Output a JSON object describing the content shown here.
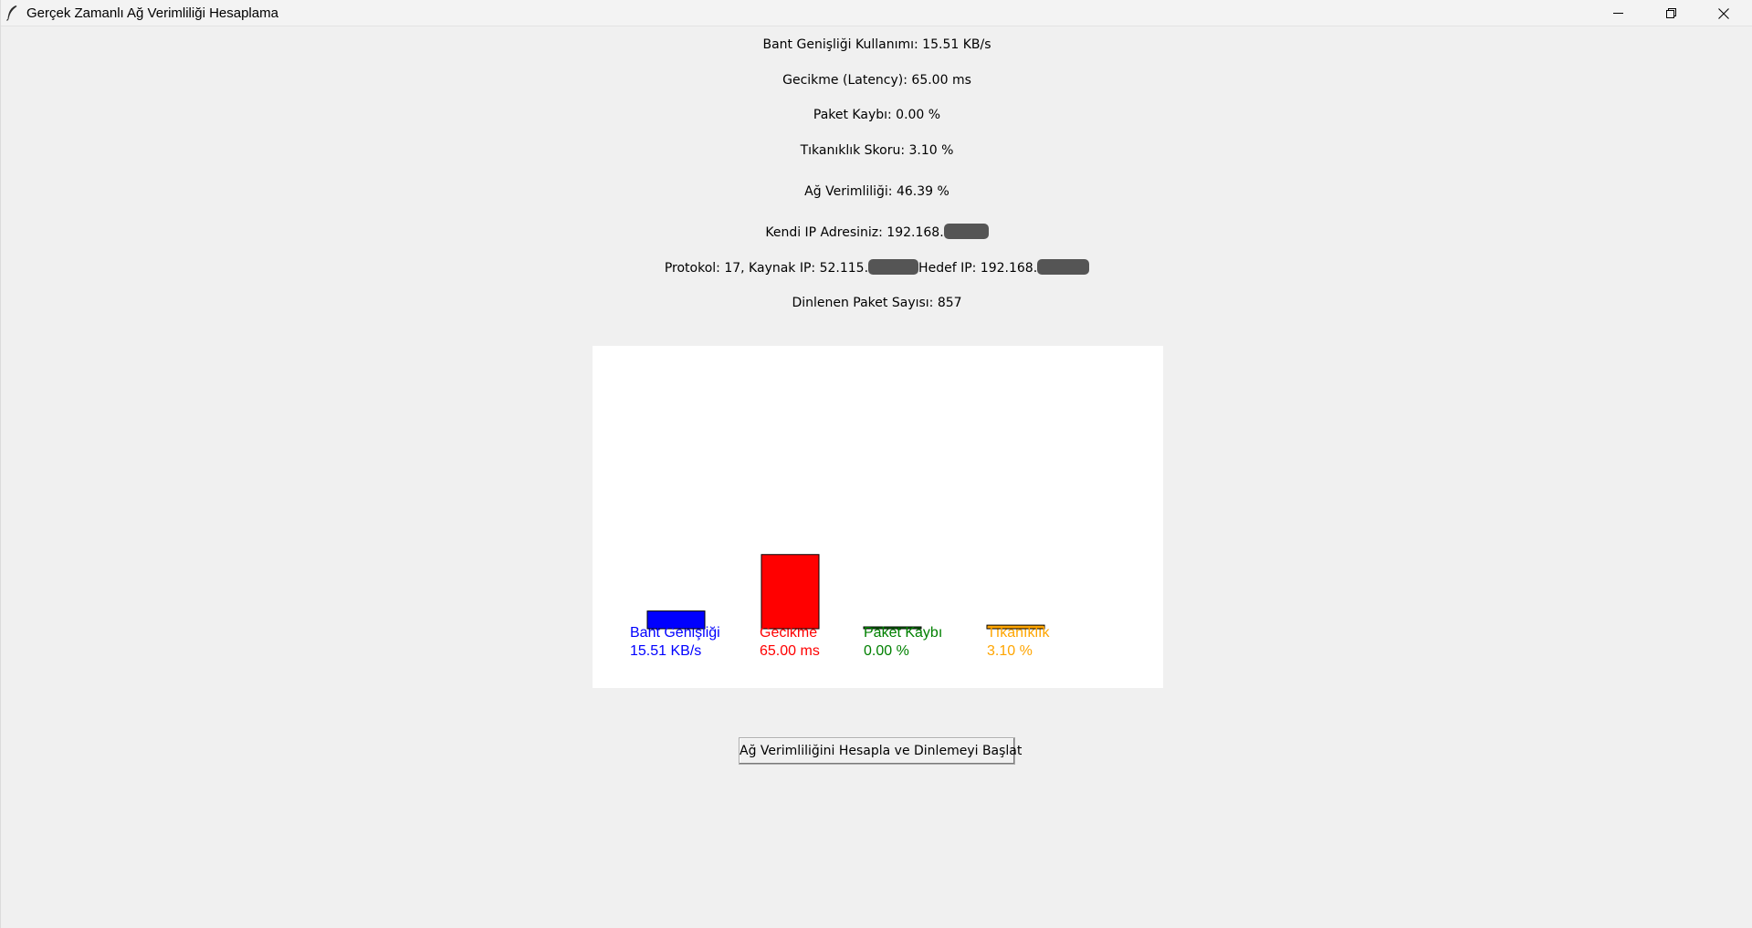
{
  "window": {
    "title": "Gerçek Zamanlı Ağ Verimliliği Hesaplama",
    "icon": "feather-icon",
    "controls": [
      "minimize-icon",
      "restore-icon",
      "close-icon"
    ]
  },
  "stats": {
    "bandwidth": "Bant Genişliği Kullanımı: 15.51 KB/s",
    "latency": "Gecikme (Latency): 65.00 ms",
    "packet_loss": "Paket Kaybı: 0.00 %",
    "congestion": "Tıkanıklık Skoru: 3.10 %",
    "efficiency": "Ağ Verimliliği: 46.39 %",
    "own_ip_prefix": "Kendi IP Adresiniz: 192.168.",
    "protocol_prefix": "Protokol: 17, Kaynak IP: 52.115.",
    "dest_prefix": "Hedef IP: 192.168.",
    "packets": "Dinlenen Paket Sayısı: 857"
  },
  "chart_data": {
    "type": "bar",
    "categories": [
      "Bant Genişliği",
      "Gecikme",
      "Paket Kaybı",
      "Tıkanıklık"
    ],
    "values": [
      15.51,
      65.0,
      0.0,
      3.1
    ],
    "value_labels": [
      "15.51 KB/s",
      "65.00 ms",
      "0.00 %",
      "3.10 %"
    ],
    "colors": [
      "#0000ff",
      "#ff0000",
      "#008000",
      "#ffa500"
    ],
    "label_colors": [
      "#0000ff",
      "#ff0000",
      "#008000",
      "#ffa500"
    ],
    "title": "",
    "xlabel": "",
    "ylabel": "",
    "grid": false,
    "legend": "none"
  },
  "actions": {
    "start_button": "Ağ Verimliliğini Hesapla ve Dinlemeyi Başlat"
  }
}
